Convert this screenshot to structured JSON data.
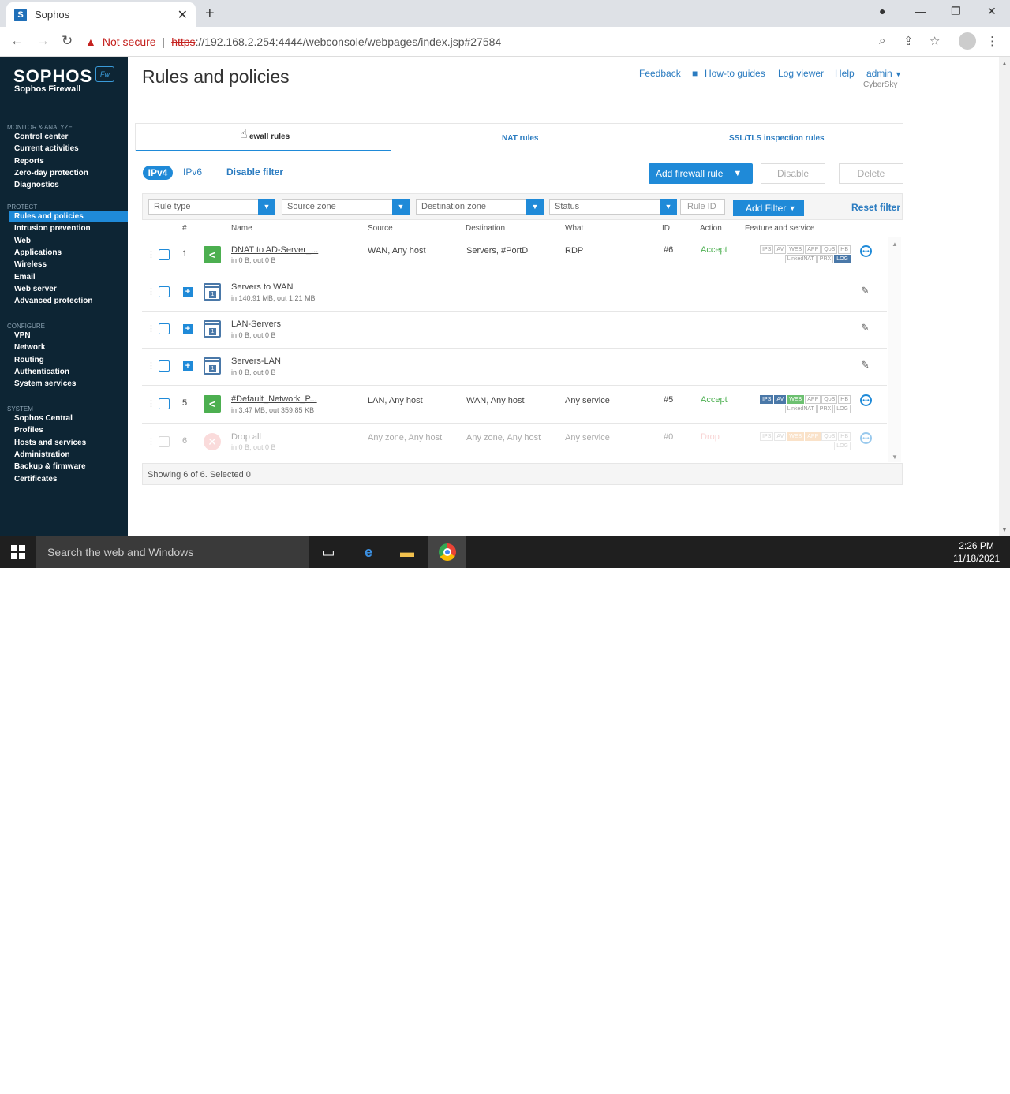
{
  "browser": {
    "tab_title": "Sophos",
    "favicon": "S",
    "security_label": "Not secure",
    "url_scheme": "https",
    "url_rest": "://192.168.2.254:4444/webconsole/webpages/index.jsp#27584"
  },
  "sidebar": {
    "brand": "SOPHOS",
    "brand_badge": "Fw",
    "product": "Sophos Firewall",
    "sections": [
      {
        "title": "MONITOR & ANALYZE",
        "items": [
          "Control center",
          "Current activities",
          "Reports",
          "Zero-day protection",
          "Diagnostics"
        ]
      },
      {
        "title": "PROTECT",
        "items": [
          "Rules and policies",
          "Intrusion prevention",
          "Web",
          "Applications",
          "Wireless",
          "Email",
          "Web server",
          "Advanced protection"
        ]
      },
      {
        "title": "CONFIGURE",
        "items": [
          "VPN",
          "Network",
          "Routing",
          "Authentication",
          "System services"
        ]
      },
      {
        "title": "SYSTEM",
        "items": [
          "Sophos Central",
          "Profiles",
          "Hosts and services",
          "Administration",
          "Backup & firmware",
          "Certificates"
        ]
      }
    ],
    "active_item": "Rules and policies"
  },
  "header": {
    "title": "Rules and policies",
    "links": [
      "Feedback",
      "How-to guides",
      "Log viewer",
      "Help",
      "admin"
    ],
    "company": "CyberSky"
  },
  "tabs": [
    "ewall rules",
    "NAT rules",
    "SSL/TLS inspection rules"
  ],
  "toolbar": {
    "ipv4": "IPv4",
    "ipv6": "IPv6",
    "disable_filter": "Disable filter",
    "add_rule": "Add firewall rule",
    "disable": "Disable",
    "delete": "Delete"
  },
  "filters": {
    "rule_type": "Rule type",
    "source_zone": "Source zone",
    "destination_zone": "Destination zone",
    "status": "Status",
    "rule_id_placeholder": "Rule ID",
    "add_filter": "Add Filter",
    "reset_filter": "Reset filter"
  },
  "columns": [
    "#",
    "Name",
    "Source",
    "Destination",
    "What",
    "ID",
    "Action",
    "Feature and service"
  ],
  "rows": [
    {
      "num": "1",
      "name": "DNAT to AD-Server_...",
      "traffic": "in 0 B, out 0 B",
      "source": "WAN, Any host",
      "destination": "Servers, #PortD",
      "what": "RDP",
      "id": "#6",
      "action": "Accept"
    },
    {
      "num": "",
      "name": "Servers to WAN",
      "traffic": "in 140.91 MB, out 1.21 MB"
    },
    {
      "num": "",
      "name": "LAN-Servers",
      "traffic": "in 0 B, out 0 B"
    },
    {
      "num": "",
      "name": "Servers-LAN",
      "traffic": "in 0 B, out 0 B"
    },
    {
      "num": "5",
      "name": "#Default_Network_P...",
      "traffic": "in 3.47 MB, out 359.85 KB",
      "source": "LAN, Any host",
      "destination": "WAN, Any host",
      "what": "Any service",
      "id": "#5",
      "action": "Accept"
    },
    {
      "num": "6",
      "name": "Drop all",
      "traffic": "in 0 B, out 0 B",
      "source": "Any zone, Any host",
      "destination": "Any zone, Any host",
      "what": "Any service",
      "id": "#0",
      "action": "Drop"
    }
  ],
  "chips": {
    "row1": [
      "IPS",
      "AV",
      "WEB",
      "APP",
      "QoS",
      "HB",
      "LinkedNAT",
      "PRX",
      "LOG"
    ],
    "row5": [
      "IPS",
      "AV",
      "WEB",
      "APP",
      "QoS",
      "HB",
      "LinkedNAT",
      "PRX",
      "LOG"
    ],
    "row6": [
      "IPS",
      "AV",
      "WEB",
      "APP",
      "QoS",
      "HB",
      "LOG"
    ]
  },
  "footer": "Showing 6 of 6. Selected 0",
  "taskbar": {
    "search": "Search the web and Windows",
    "time": "2:26 PM",
    "date": "11/18/2021"
  },
  "colors": {
    "accent": "#1f8ad8",
    "sidebar": "#0d2534",
    "accept": "#4caf50"
  }
}
